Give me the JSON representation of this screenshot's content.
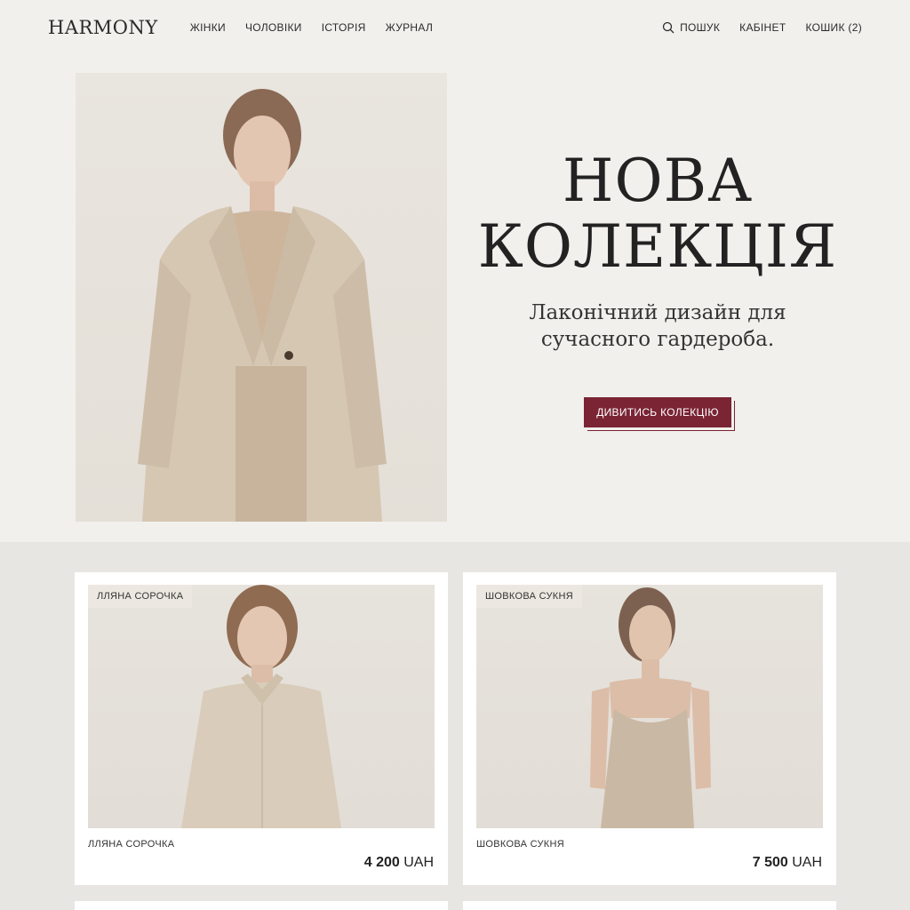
{
  "header": {
    "logo": "HARMONY",
    "nav": [
      "ЖІНКИ",
      "ЧОЛОВІКИ",
      "ІСТОРІЯ",
      "ЖУРНАЛ"
    ],
    "search_label": "ПОШУК",
    "account_label": "КАБІНЕТ",
    "cart_label": "КОШИК",
    "cart_count": "(2)"
  },
  "hero": {
    "title": "НОВА\nКОЛЕКЦІЯ",
    "subtitle": "Лаконічний дизайн для\nсучасного гардероба.",
    "cta": "ДИВИТИСЬ КОЛЕКЦІЮ",
    "image_icon": "model-in-beige-coat"
  },
  "products": [
    {
      "badge": "ЛЛЯНА СОРОЧКА",
      "name": "ЛЛЯНА СОРОЧКА",
      "price_value": "4 200",
      "currency": "UAH",
      "image_icon": "model-in-linen-shirt"
    },
    {
      "badge": "ШОВКОВА СУКНЯ",
      "name": "ШОВКОВА СУКНЯ",
      "price_value": "7 500",
      "currency": "UAH",
      "image_icon": "model-in-silk-dress"
    }
  ],
  "colors": {
    "accent": "#7a2434",
    "background": "#f2f0ec",
    "section_bg": "#e8e6e3"
  }
}
